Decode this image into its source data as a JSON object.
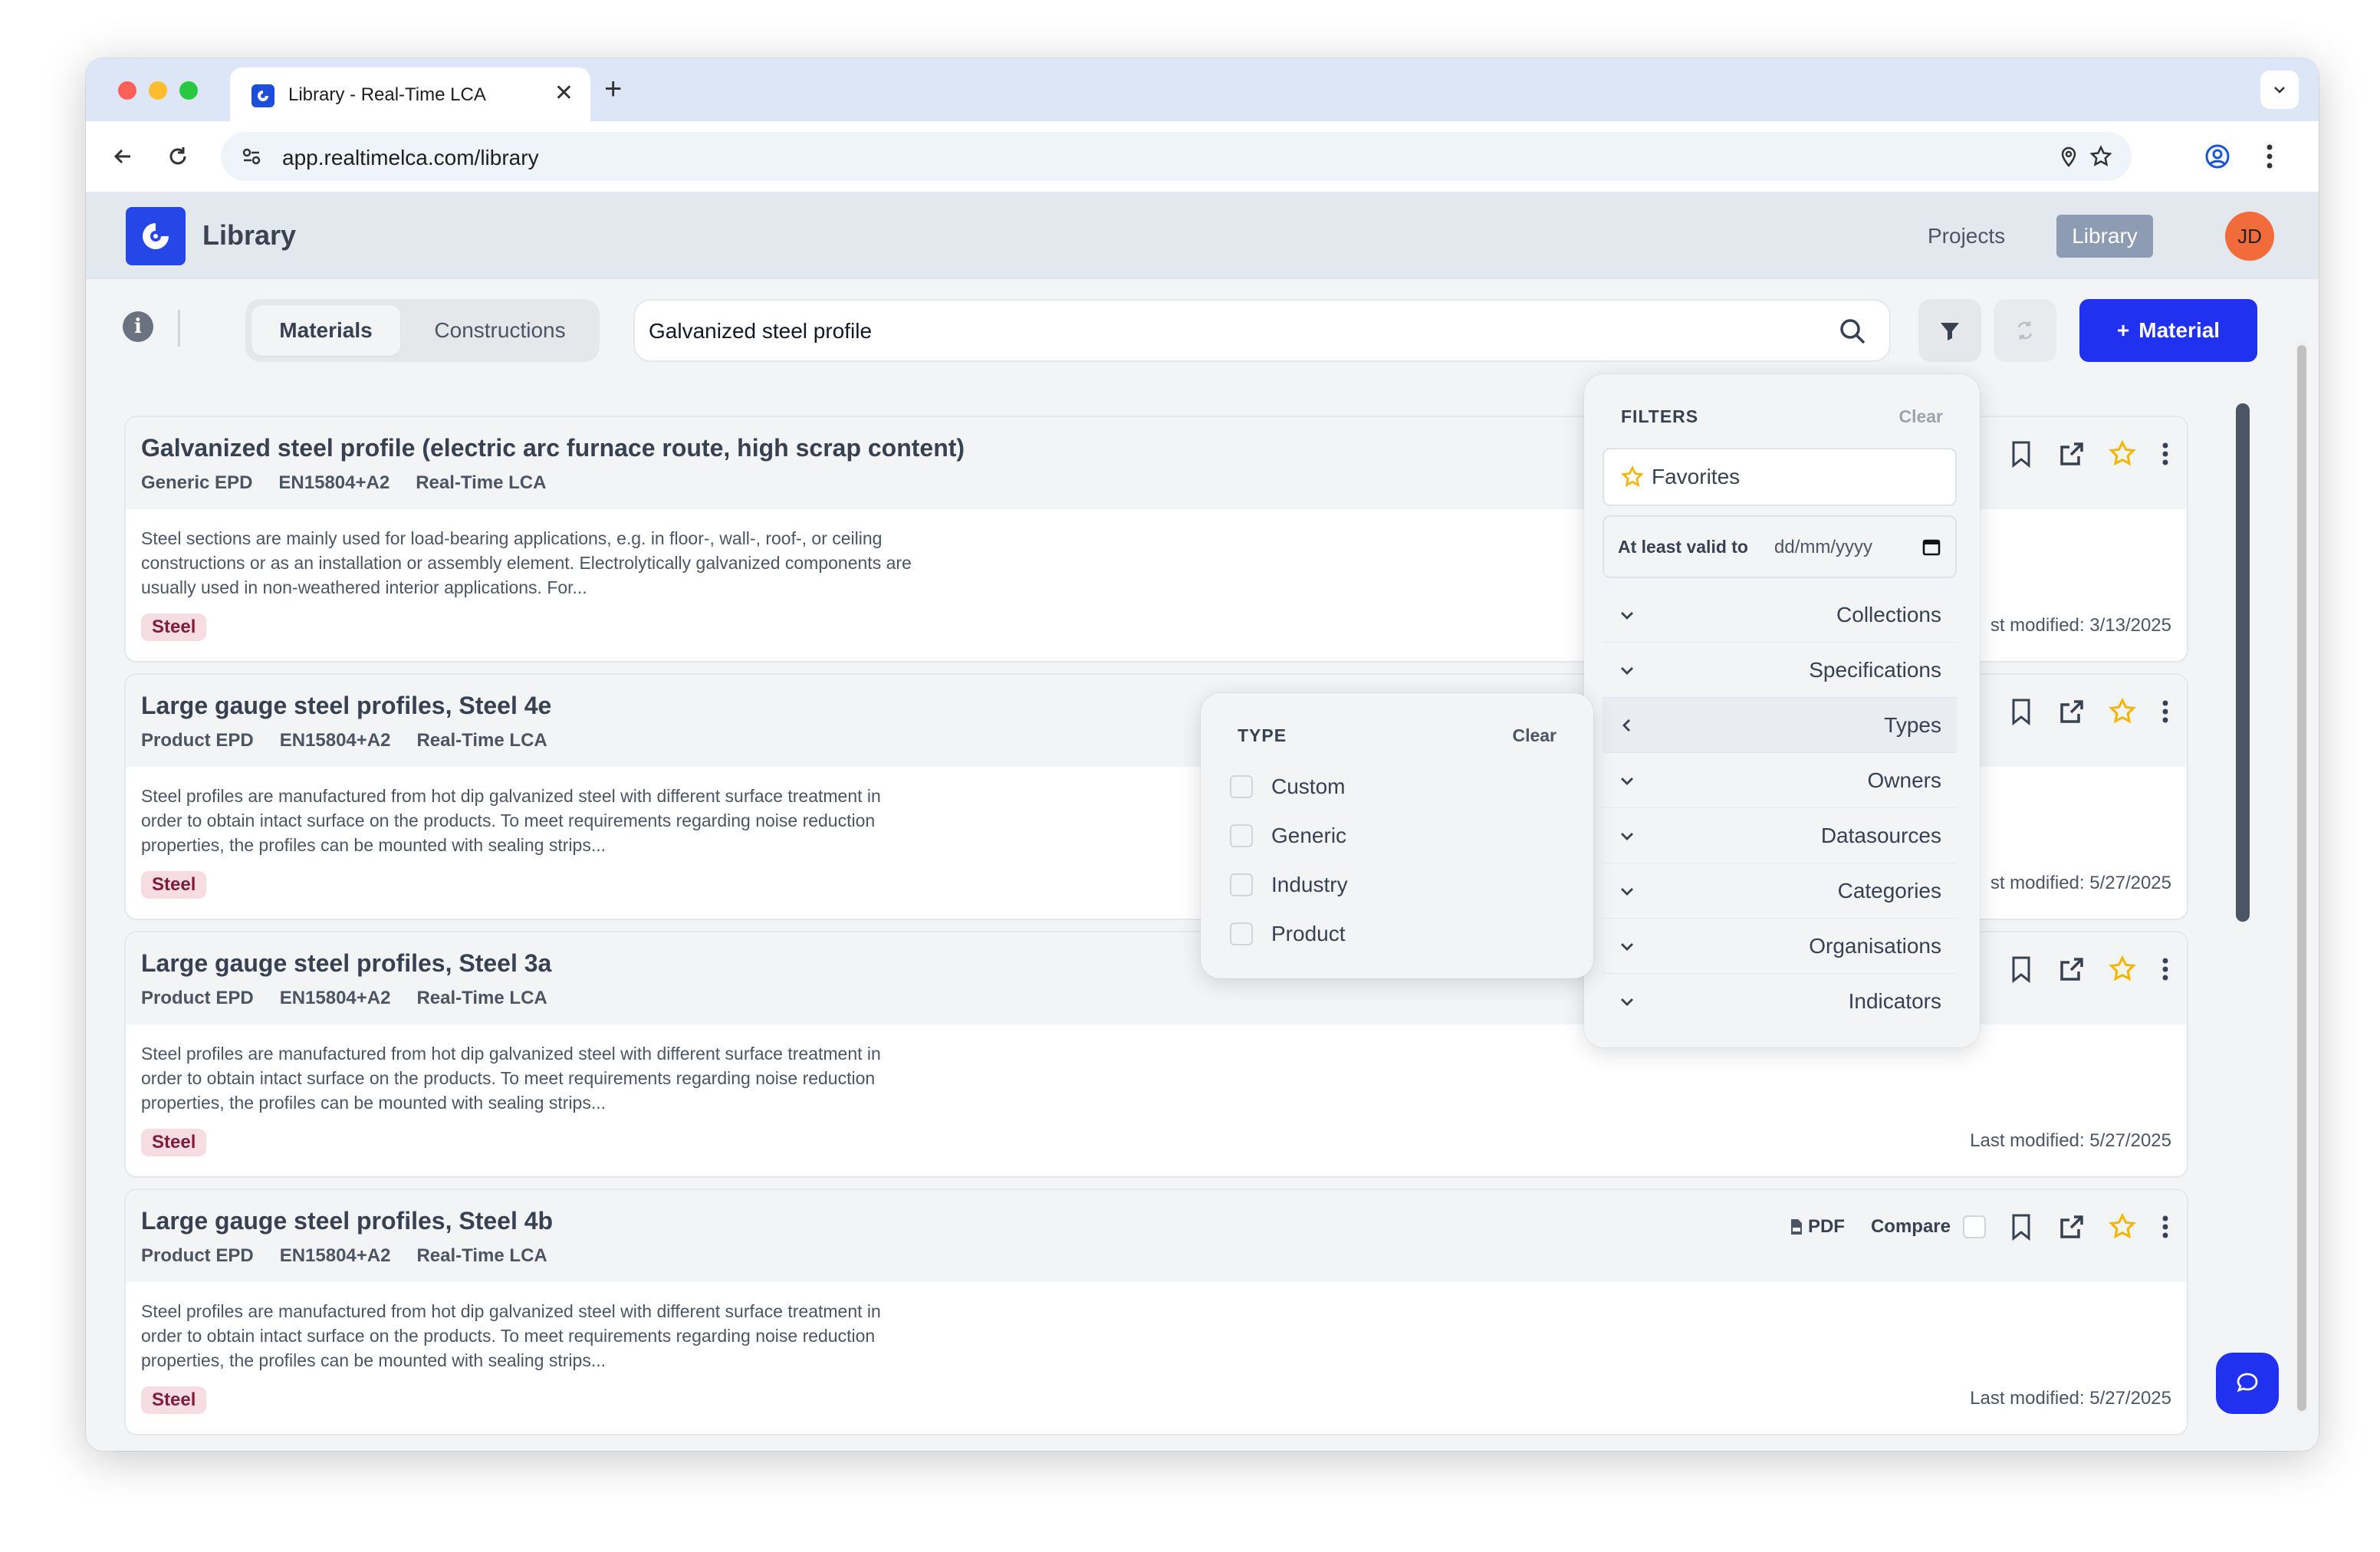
{
  "browser": {
    "tab_title": "Library - Real-Time LCA",
    "new_tab": "+",
    "tab_close": "✕",
    "url": "app.realtimelca.com/library"
  },
  "header": {
    "app_title": "Library",
    "nav": {
      "projects": "Projects",
      "library": "Library"
    },
    "avatar_initials": "JD"
  },
  "toolbar": {
    "tabs": {
      "materials": "Materials",
      "constructions": "Constructions"
    },
    "search_value": "Galvanized steel profile",
    "add_label": "Material",
    "add_plus": "+"
  },
  "cards": [
    {
      "title": "Galvanized steel profile (electric arc furnace route, high scrap content)",
      "type": "Generic EPD",
      "standard": "EN15804+A2",
      "source": "Real-Time LCA",
      "description": "Steel sections are mainly used for load-bearing applications, e.g. in floor-, wall-, roof-, or ceiling constructions or as an installation or assembly element. Electrolytically galvanized components are usually used in non-weathered interior applications. For...",
      "tag": "Steel",
      "modified": "st modified: 3/13/2025"
    },
    {
      "title": "Large gauge steel profiles, Steel 4e",
      "type": "Product EPD",
      "standard": "EN15804+A2",
      "source": "Real-Time LCA",
      "description": "Steel profiles are manufactured from hot dip galvanized steel with different surface treatment in order to obtain intact surface on the products. To meet requirements regarding noise reduction properties, the profiles can be mounted with sealing strips...",
      "tag": "Steel",
      "modified": "st modified: 5/27/2025"
    },
    {
      "title": "Large gauge steel profiles, Steel 3a",
      "type": "Product EPD",
      "standard": "EN15804+A2",
      "source": "Real-Time LCA",
      "description": "Steel profiles are manufactured from hot dip galvanized steel with different surface treatment in order to obtain intact surface on the products. To meet requirements regarding noise reduction properties, the profiles can be mounted with sealing strips...",
      "tag": "Steel",
      "modified": "Last modified: 5/27/2025"
    },
    {
      "title": "Large gauge steel profiles, Steel 4b",
      "type": "Product EPD",
      "standard": "EN15804+A2",
      "source": "Real-Time LCA",
      "description": "Steel profiles are manufactured from hot dip galvanized steel with different surface treatment in order to obtain intact surface on the products. To meet requirements regarding noise reduction properties, the profiles can be mounted with sealing strips...",
      "tag": "Steel",
      "modified": "Last modified: 5/27/2025",
      "pdf_label": "PDF",
      "compare_label": "Compare"
    }
  ],
  "filters": {
    "title": "FILTERS",
    "clear": "Clear",
    "favorites": "Favorites",
    "valid_label": "At least valid to",
    "valid_placeholder": "dd/mm/yyyy",
    "sections": [
      "Collections",
      "Specifications",
      "Types",
      "Owners",
      "Datasources",
      "Categories",
      "Organisations",
      "Indicators"
    ],
    "active_section": "Types"
  },
  "type_filter": {
    "title": "TYPE",
    "clear": "Clear",
    "options": [
      "Custom",
      "Generic",
      "Industry",
      "Product"
    ]
  },
  "colors": {
    "primary": "#2032f0",
    "logo": "#2547e8",
    "star": "#f5b400",
    "tag_bg": "#f6dce3",
    "avatar": "#f26b3a"
  }
}
